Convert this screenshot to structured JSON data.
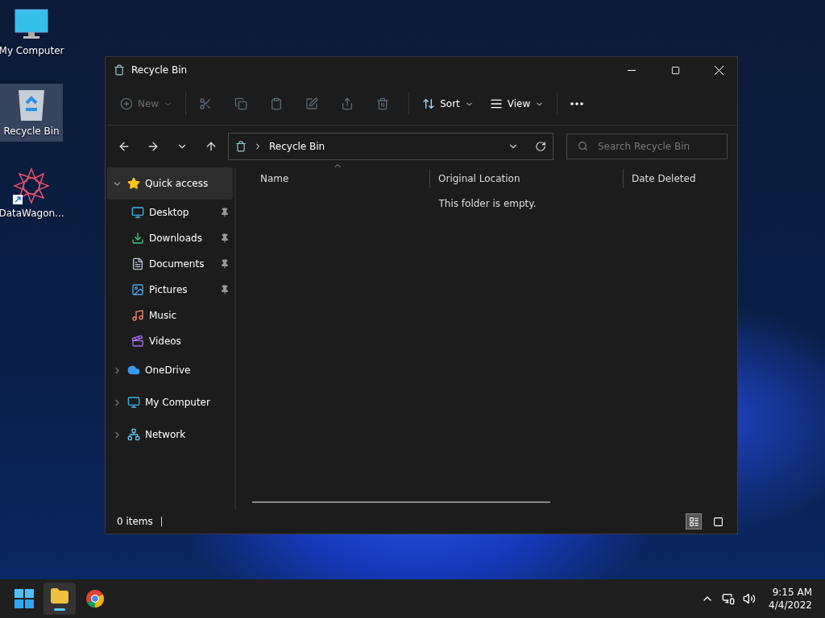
{
  "desktop_icons": [
    {
      "kind": "computer",
      "label": "My Computer",
      "selected": false
    },
    {
      "kind": "recycle",
      "label": "Recycle Bin",
      "selected": true
    },
    {
      "kind": "app",
      "label": "DataWagon...",
      "selected": false
    }
  ],
  "window": {
    "title": "Recycle Bin",
    "toolbar": [
      {
        "kind": "new",
        "label": "New",
        "disabled": true
      },
      {
        "kind": "cut",
        "disabled": true
      },
      {
        "kind": "copy",
        "disabled": true
      },
      {
        "kind": "paste",
        "disabled": true
      },
      {
        "kind": "rename",
        "disabled": true
      },
      {
        "kind": "share",
        "disabled": true
      },
      {
        "kind": "delete",
        "disabled": true
      },
      {
        "kind": "sort",
        "label": "Sort",
        "disabled": false
      },
      {
        "kind": "view",
        "label": "View",
        "disabled": false
      },
      {
        "kind": "more",
        "disabled": false
      }
    ],
    "address": {
      "path": "Recycle Bin"
    },
    "search": {
      "placeholder": "Search Recycle Bin"
    },
    "sidebar": {
      "items": [
        {
          "kind": "star",
          "label": "Quick access",
          "expanded": true,
          "selected": true,
          "children": [
            {
              "kind": "desktop",
              "label": "Desktop",
              "pinned": true,
              "selected": false
            },
            {
              "kind": "downloads",
              "label": "Downloads",
              "pinned": true,
              "selected": false
            },
            {
              "kind": "documents",
              "label": "Documents",
              "pinned": true,
              "selected": false
            },
            {
              "kind": "pictures",
              "label": "Pictures",
              "pinned": true,
              "selected": false
            },
            {
              "kind": "music",
              "label": "Music",
              "pinned": false,
              "selected": false
            },
            {
              "kind": "videos",
              "label": "Videos",
              "pinned": false,
              "selected": false
            }
          ]
        },
        {
          "kind": "cloud",
          "label": "OneDrive",
          "expanded": false,
          "selected": false
        },
        {
          "kind": "computer",
          "label": "My Computer",
          "expanded": false,
          "selected": false
        },
        {
          "kind": "network",
          "label": "Network",
          "expanded": false,
          "selected": false
        }
      ]
    },
    "table": {
      "columns": [
        {
          "label": "Name",
          "sorted": true
        },
        {
          "label": "Original Location",
          "sorted": false
        },
        {
          "label": "Date Deleted",
          "sorted": false
        }
      ],
      "empty_message": "This folder is empty."
    },
    "status_bar": {
      "count": "0 items",
      "views": [
        {
          "kind": "details",
          "selected": true
        },
        {
          "kind": "tiles",
          "selected": false
        }
      ]
    }
  },
  "taskbar": {
    "apps": [
      {
        "kind": "start",
        "active": false
      },
      {
        "kind": "explorer",
        "active": true
      },
      {
        "kind": "browser",
        "active": false
      }
    ],
    "time": "9:15 AM",
    "date": "4/4/2022"
  }
}
